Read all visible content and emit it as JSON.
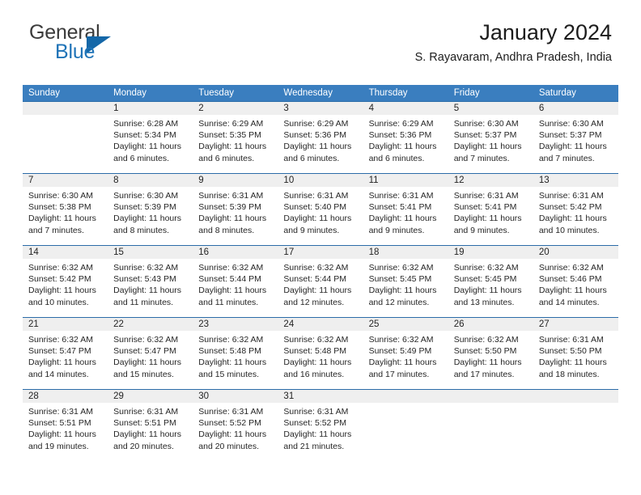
{
  "brand": {
    "word1": "General",
    "word2": "Blue",
    "flag_icon": "triangle-flag-icon",
    "accent_color": "#1467a8"
  },
  "header": {
    "title": "January 2024",
    "subtitle": "S. Rayavaram, Andhra Pradesh, India"
  },
  "theme": {
    "header_row_bg": "#3a7ebf",
    "week_divider": "#2b6ca8",
    "daynum_band_bg": "#efefef",
    "cell_bg": "#ffffff",
    "text": "#262626"
  },
  "weekdays": [
    "Sunday",
    "Monday",
    "Tuesday",
    "Wednesday",
    "Thursday",
    "Friday",
    "Saturday"
  ],
  "weeks": [
    [
      {
        "day": "",
        "l1": "",
        "l2": "",
        "l3": "",
        "l4": ""
      },
      {
        "day": "1",
        "l1": "Sunrise: 6:28 AM",
        "l2": "Sunset: 5:34 PM",
        "l3": "Daylight: 11 hours",
        "l4": "and 6 minutes."
      },
      {
        "day": "2",
        "l1": "Sunrise: 6:29 AM",
        "l2": "Sunset: 5:35 PM",
        "l3": "Daylight: 11 hours",
        "l4": "and 6 minutes."
      },
      {
        "day": "3",
        "l1": "Sunrise: 6:29 AM",
        "l2": "Sunset: 5:36 PM",
        "l3": "Daylight: 11 hours",
        "l4": "and 6 minutes."
      },
      {
        "day": "4",
        "l1": "Sunrise: 6:29 AM",
        "l2": "Sunset: 5:36 PM",
        "l3": "Daylight: 11 hours",
        "l4": "and 6 minutes."
      },
      {
        "day": "5",
        "l1": "Sunrise: 6:30 AM",
        "l2": "Sunset: 5:37 PM",
        "l3": "Daylight: 11 hours",
        "l4": "and 7 minutes."
      },
      {
        "day": "6",
        "l1": "Sunrise: 6:30 AM",
        "l2": "Sunset: 5:37 PM",
        "l3": "Daylight: 11 hours",
        "l4": "and 7 minutes."
      }
    ],
    [
      {
        "day": "7",
        "l1": "Sunrise: 6:30 AM",
        "l2": "Sunset: 5:38 PM",
        "l3": "Daylight: 11 hours",
        "l4": "and 7 minutes."
      },
      {
        "day": "8",
        "l1": "Sunrise: 6:30 AM",
        "l2": "Sunset: 5:39 PM",
        "l3": "Daylight: 11 hours",
        "l4": "and 8 minutes."
      },
      {
        "day": "9",
        "l1": "Sunrise: 6:31 AM",
        "l2": "Sunset: 5:39 PM",
        "l3": "Daylight: 11 hours",
        "l4": "and 8 minutes."
      },
      {
        "day": "10",
        "l1": "Sunrise: 6:31 AM",
        "l2": "Sunset: 5:40 PM",
        "l3": "Daylight: 11 hours",
        "l4": "and 9 minutes."
      },
      {
        "day": "11",
        "l1": "Sunrise: 6:31 AM",
        "l2": "Sunset: 5:41 PM",
        "l3": "Daylight: 11 hours",
        "l4": "and 9 minutes."
      },
      {
        "day": "12",
        "l1": "Sunrise: 6:31 AM",
        "l2": "Sunset: 5:41 PM",
        "l3": "Daylight: 11 hours",
        "l4": "and 9 minutes."
      },
      {
        "day": "13",
        "l1": "Sunrise: 6:31 AM",
        "l2": "Sunset: 5:42 PM",
        "l3": "Daylight: 11 hours",
        "l4": "and 10 minutes."
      }
    ],
    [
      {
        "day": "14",
        "l1": "Sunrise: 6:32 AM",
        "l2": "Sunset: 5:42 PM",
        "l3": "Daylight: 11 hours",
        "l4": "and 10 minutes."
      },
      {
        "day": "15",
        "l1": "Sunrise: 6:32 AM",
        "l2": "Sunset: 5:43 PM",
        "l3": "Daylight: 11 hours",
        "l4": "and 11 minutes."
      },
      {
        "day": "16",
        "l1": "Sunrise: 6:32 AM",
        "l2": "Sunset: 5:44 PM",
        "l3": "Daylight: 11 hours",
        "l4": "and 11 minutes."
      },
      {
        "day": "17",
        "l1": "Sunrise: 6:32 AM",
        "l2": "Sunset: 5:44 PM",
        "l3": "Daylight: 11 hours",
        "l4": "and 12 minutes."
      },
      {
        "day": "18",
        "l1": "Sunrise: 6:32 AM",
        "l2": "Sunset: 5:45 PM",
        "l3": "Daylight: 11 hours",
        "l4": "and 12 minutes."
      },
      {
        "day": "19",
        "l1": "Sunrise: 6:32 AM",
        "l2": "Sunset: 5:45 PM",
        "l3": "Daylight: 11 hours",
        "l4": "and 13 minutes."
      },
      {
        "day": "20",
        "l1": "Sunrise: 6:32 AM",
        "l2": "Sunset: 5:46 PM",
        "l3": "Daylight: 11 hours",
        "l4": "and 14 minutes."
      }
    ],
    [
      {
        "day": "21",
        "l1": "Sunrise: 6:32 AM",
        "l2": "Sunset: 5:47 PM",
        "l3": "Daylight: 11 hours",
        "l4": "and 14 minutes."
      },
      {
        "day": "22",
        "l1": "Sunrise: 6:32 AM",
        "l2": "Sunset: 5:47 PM",
        "l3": "Daylight: 11 hours",
        "l4": "and 15 minutes."
      },
      {
        "day": "23",
        "l1": "Sunrise: 6:32 AM",
        "l2": "Sunset: 5:48 PM",
        "l3": "Daylight: 11 hours",
        "l4": "and 15 minutes."
      },
      {
        "day": "24",
        "l1": "Sunrise: 6:32 AM",
        "l2": "Sunset: 5:48 PM",
        "l3": "Daylight: 11 hours",
        "l4": "and 16 minutes."
      },
      {
        "day": "25",
        "l1": "Sunrise: 6:32 AM",
        "l2": "Sunset: 5:49 PM",
        "l3": "Daylight: 11 hours",
        "l4": "and 17 minutes."
      },
      {
        "day": "26",
        "l1": "Sunrise: 6:32 AM",
        "l2": "Sunset: 5:50 PM",
        "l3": "Daylight: 11 hours",
        "l4": "and 17 minutes."
      },
      {
        "day": "27",
        "l1": "Sunrise: 6:31 AM",
        "l2": "Sunset: 5:50 PM",
        "l3": "Daylight: 11 hours",
        "l4": "and 18 minutes."
      }
    ],
    [
      {
        "day": "28",
        "l1": "Sunrise: 6:31 AM",
        "l2": "Sunset: 5:51 PM",
        "l3": "Daylight: 11 hours",
        "l4": "and 19 minutes."
      },
      {
        "day": "29",
        "l1": "Sunrise: 6:31 AM",
        "l2": "Sunset: 5:51 PM",
        "l3": "Daylight: 11 hours",
        "l4": "and 20 minutes."
      },
      {
        "day": "30",
        "l1": "Sunrise: 6:31 AM",
        "l2": "Sunset: 5:52 PM",
        "l3": "Daylight: 11 hours",
        "l4": "and 20 minutes."
      },
      {
        "day": "31",
        "l1": "Sunrise: 6:31 AM",
        "l2": "Sunset: 5:52 PM",
        "l3": "Daylight: 11 hours",
        "l4": "and 21 minutes."
      },
      {
        "day": "",
        "l1": "",
        "l2": "",
        "l3": "",
        "l4": ""
      },
      {
        "day": "",
        "l1": "",
        "l2": "",
        "l3": "",
        "l4": ""
      },
      {
        "day": "",
        "l1": "",
        "l2": "",
        "l3": "",
        "l4": ""
      }
    ]
  ]
}
